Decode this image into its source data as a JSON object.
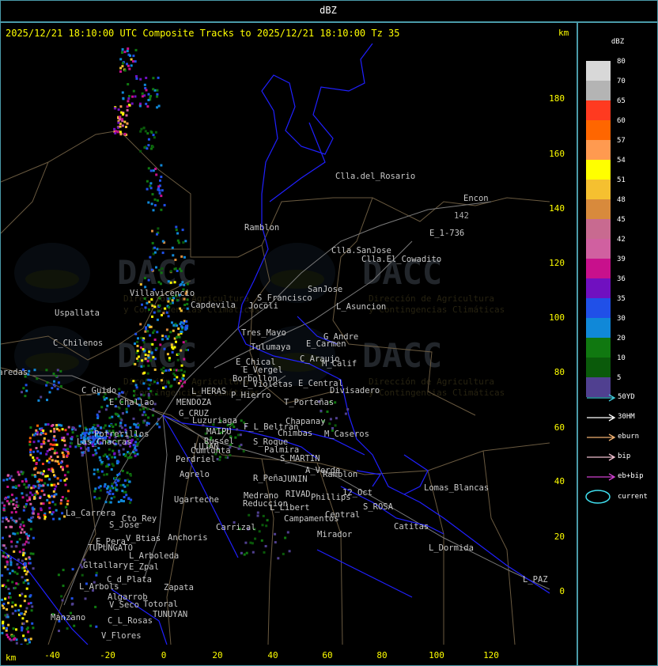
{
  "window": {
    "title": "dBZ"
  },
  "header": {
    "text": "2025/12/21 18:10:00 UTC Composite Tracks to 2025/12/21 18:10:00 Tz 35",
    "unit_top": "km",
    "unit_bottom": "km"
  },
  "watermark": {
    "text": "DACC",
    "subtitle_1": "Dirección de Agricultura",
    "subtitle_2": "y Contingencias Climáticas"
  },
  "axes": {
    "x_ticks": [
      "-40",
      "-20",
      "0",
      "20",
      "40",
      "60",
      "80",
      "100",
      "120"
    ],
    "y_ticks": [
      "180",
      "160",
      "140",
      "120",
      "100",
      "80",
      "60",
      "40",
      "20",
      "0"
    ]
  },
  "places": [
    {
      "name": "Clla.del_Rosario",
      "color": "#c8c8c8"
    },
    {
      "name": "Encon",
      "color": "#c8c8c8"
    },
    {
      "name": "142",
      "color": "#aaaaaa"
    },
    {
      "name": "E_1-736",
      "color": "#c8c8c8"
    },
    {
      "name": "Ramblon",
      "color": "#c8c8c8"
    },
    {
      "name": "Clla.SanJose",
      "color": "#c8c8c8"
    },
    {
      "name": "Clla.El_Cowadito",
      "color": "#c8c8c8"
    },
    {
      "name": "S_Francisco",
      "color": "#c8c8c8"
    },
    {
      "name": "SanJose",
      "color": "#c8c8c8"
    },
    {
      "name": "Villavicencio",
      "color": "#c8c8c8"
    },
    {
      "name": "Capdevila",
      "color": "#c8c8c8"
    },
    {
      "name": "Jocoli",
      "color": "#c8c8c8"
    },
    {
      "name": "L_Asuncion",
      "color": "#c8c8c8"
    },
    {
      "name": "Uspallata",
      "color": "#c8c8c8"
    },
    {
      "name": "Tres_Mayo",
      "color": "#c8c8c8"
    },
    {
      "name": "G_Andre",
      "color": "#c8c8c8"
    },
    {
      "name": "E_Carmen",
      "color": "#c8c8c8"
    },
    {
      "name": "Tulumaya",
      "color": "#c8c8c8"
    },
    {
      "name": "C_Chilenos",
      "color": "#c8c8c8"
    },
    {
      "name": "C_Araujo",
      "color": "#c8c8c8"
    },
    {
      "name": "M_Calif",
      "color": "#c8c8c8"
    },
    {
      "name": "E_Chical",
      "color": "#c8c8c8"
    },
    {
      "name": "E_Vergel",
      "color": "#c8c8c8"
    },
    {
      "name": "Paredas",
      "color": "#c8c8c8"
    },
    {
      "name": "Borbollon",
      "color": "#c8c8c8"
    },
    {
      "name": "L_Violetas",
      "color": "#c8c8c8"
    },
    {
      "name": "E_Central",
      "color": "#c8c8c8"
    },
    {
      "name": "Divisadero",
      "color": "#c8c8c8"
    },
    {
      "name": "L_HERAS",
      "color": "#c8c8c8"
    },
    {
      "name": "P_Hierro",
      "color": "#c8c8c8"
    },
    {
      "name": "C_Guido",
      "color": "#c8c8c8"
    },
    {
      "name": "E_Challao",
      "color": "#c8c8c8"
    },
    {
      "name": "MENDOZA",
      "color": "#c8c8c8"
    },
    {
      "name": "T_Porteñas",
      "color": "#c8c8c8"
    },
    {
      "name": "G_CRUZ",
      "color": "#c8c8c8"
    },
    {
      "name": "Chapanay",
      "color": "#c8c8c8"
    },
    {
      "name": "Luzuriaga",
      "color": "#c8c8c8"
    },
    {
      "name": "F_L_Beltran",
      "color": "#c8c8c8"
    },
    {
      "name": "MAIPU",
      "color": "#c8c8c8"
    },
    {
      "name": "Chimbas",
      "color": "#c8c8c8"
    },
    {
      "name": "M_Caseros",
      "color": "#c8c8c8"
    },
    {
      "name": "Potrerillos",
      "color": "#c8c8c8"
    },
    {
      "name": "Russel",
      "color": "#c8c8c8"
    },
    {
      "name": "S_Roque",
      "color": "#c8c8c8"
    },
    {
      "name": "Las_Chacras",
      "color": "#c8c8c8"
    },
    {
      "name": "LUJAN",
      "color": "#c8c8c8"
    },
    {
      "name": "Palmira",
      "color": "#c8c8c8"
    },
    {
      "name": "Cumlunta",
      "color": "#c8c8c8"
    },
    {
      "name": "S_MARTIN",
      "color": "#c8c8c8"
    },
    {
      "name": "Perdriel",
      "color": "#c8c8c8"
    },
    {
      "name": "A_Verde",
      "color": "#c8c8c8"
    },
    {
      "name": "Ramblon",
      "color": "#c8c8c8"
    },
    {
      "name": "Agrelo",
      "color": "#c8c8c8"
    },
    {
      "name": "R_Peña",
      "color": "#c8c8c8"
    },
    {
      "name": "JUNIN",
      "color": "#c8c8c8"
    },
    {
      "name": "Lomas_Blancas",
      "color": "#c8c8c8"
    },
    {
      "name": "RIVAD",
      "color": "#c8c8c8"
    },
    {
      "name": "12_Oct",
      "color": "#c8c8c8"
    },
    {
      "name": "Medrano",
      "color": "#c8c8c8"
    },
    {
      "name": "Phillips",
      "color": "#c8c8c8"
    },
    {
      "name": "Ugarteche",
      "color": "#c8c8c8"
    },
    {
      "name": "Reduccion",
      "color": "#c8c8c8"
    },
    {
      "name": "S_ROSA",
      "color": "#c8c8c8"
    },
    {
      "name": "L_Libert",
      "color": "#c8c8c8"
    },
    {
      "name": "La_Carrera",
      "color": "#c8c8c8"
    },
    {
      "name": "Central",
      "color": "#c8c8c8"
    },
    {
      "name": "Cto_Rey",
      "color": "#c8c8c8"
    },
    {
      "name": "Campamentos",
      "color": "#c8c8c8"
    },
    {
      "name": "Catitas",
      "color": "#c8c8c8"
    },
    {
      "name": "S_Jose",
      "color": "#c8c8c8"
    },
    {
      "name": "Carrizal",
      "color": "#c8c8c8"
    },
    {
      "name": "Mirador",
      "color": "#c8c8c8"
    },
    {
      "name": "V_Btias",
      "color": "#c8c8c8"
    },
    {
      "name": "Anchoris",
      "color": "#c8c8c8"
    },
    {
      "name": "E_Pera",
      "color": "#c8c8c8"
    },
    {
      "name": "TUPUNGATO",
      "color": "#c8c8c8"
    },
    {
      "name": "L_Dormida",
      "color": "#c8c8c8"
    },
    {
      "name": "L_Arboleda",
      "color": "#c8c8c8"
    },
    {
      "name": "Gltallary",
      "color": "#c8c8c8"
    },
    {
      "name": "E_Zpal",
      "color": "#c8c8c8"
    },
    {
      "name": "C_d_Plata",
      "color": "#c8c8c8"
    },
    {
      "name": "L_Arbols",
      "color": "#c8c8c8"
    },
    {
      "name": "Zapata",
      "color": "#c8c8c8"
    },
    {
      "name": "L_PAZ",
      "color": "#c8c8c8"
    },
    {
      "name": "Algarrob",
      "color": "#c8c8c8"
    },
    {
      "name": "V_Seco",
      "color": "#c8c8c8"
    },
    {
      "name": "Totoral",
      "color": "#c8c8c8"
    },
    {
      "name": "TUNUYAN",
      "color": "#c8c8c8"
    },
    {
      "name": "Manzano",
      "color": "#c8c8c8"
    },
    {
      "name": "C_L_Rosas",
      "color": "#c8c8c8"
    },
    {
      "name": "V_Flores",
      "color": "#c8c8c8"
    }
  ],
  "legend": {
    "title": "dBZ",
    "scale": [
      {
        "label": "80",
        "color": "#d8d8d8"
      },
      {
        "label": "70",
        "color": "#b4b4b4"
      },
      {
        "label": "65",
        "color": "#ff3a20"
      },
      {
        "label": "60",
        "color": "#ff6600"
      },
      {
        "label": "57",
        "color": "#ff9a50"
      },
      {
        "label": "54",
        "color": "#ffff00"
      },
      {
        "label": "51",
        "color": "#f5c030"
      },
      {
        "label": "48",
        "color": "#d88a3c"
      },
      {
        "label": "45",
        "color": "#c86a90"
      },
      {
        "label": "42",
        "color": "#d060a0"
      },
      {
        "label": "39",
        "color": "#c8108c"
      },
      {
        "label": "36",
        "color": "#7010c0"
      },
      {
        "label": "35",
        "color": "#2050e8"
      },
      {
        "label": "30",
        "color": "#1088d8"
      },
      {
        "label": "20",
        "color": "#107810"
      },
      {
        "label": "10",
        "color": "#0a5a0a"
      },
      {
        "label": "5",
        "color": "#504090"
      }
    ],
    "tracks": [
      {
        "label": "50YD",
        "color": "#40c8d8"
      },
      {
        "label": "30HM",
        "color": "#ffffff"
      },
      {
        "label": "eburn",
        "color": "#f0b070"
      },
      {
        "label": "bip",
        "color": "#f0c0d0"
      },
      {
        "label": "eb+bip",
        "color": "#d040d0"
      }
    ],
    "current": {
      "label": "current",
      "color": "#40e0f0"
    }
  }
}
